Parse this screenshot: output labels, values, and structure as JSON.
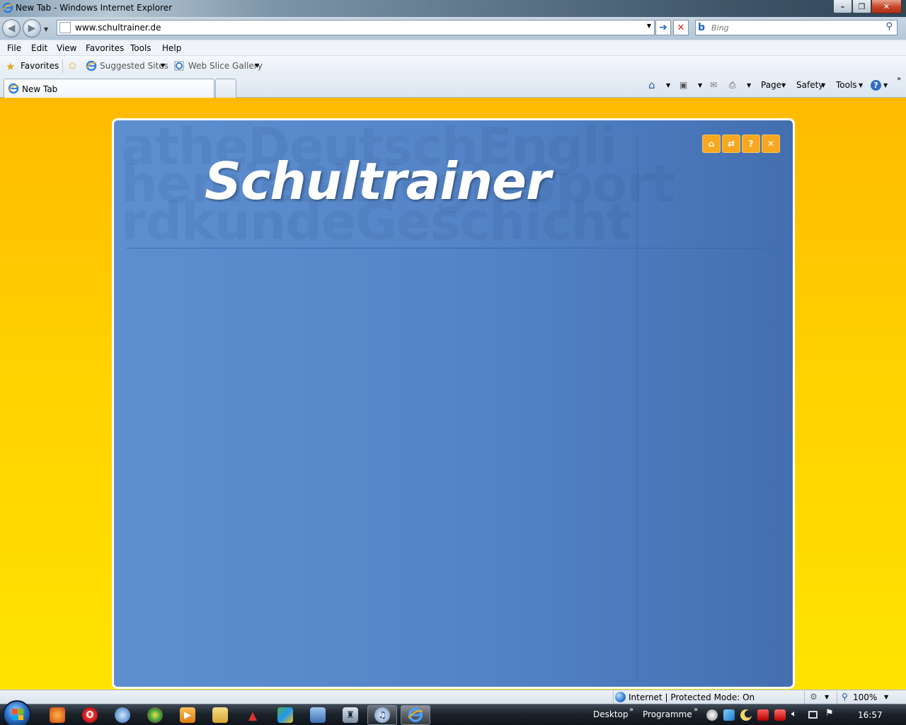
{
  "window": {
    "title": "New Tab - Windows Internet Explorer",
    "controls": {
      "minimize": "–",
      "maximize": "❐",
      "close": "✕"
    }
  },
  "nav": {
    "back_icon": "◀",
    "forward_icon": "▶",
    "url": "www.schultrainer.de",
    "search_placeholder": "Bing"
  },
  "menu": [
    "File",
    "Edit",
    "View",
    "Favorites",
    "Tools",
    "Help"
  ],
  "favorites_bar": {
    "favorites_label": "Favorites",
    "suggested_sites": "Suggested Sites",
    "web_slice_gallery": "Web Slice Gallery"
  },
  "tabs": [
    {
      "label": "New Tab",
      "active": true
    }
  ],
  "command_bar": [
    "Page",
    "Safety",
    "Tools"
  ],
  "page": {
    "background_words": [
      "atheDeutschEngli",
      "hemieBiologieSport",
      "rdkundeGeschicht"
    ],
    "logo_text": "Schultrainer",
    "app_buttons": [
      {
        "icon": "home-icon",
        "glyph": "⌂"
      },
      {
        "icon": "swap-icon",
        "glyph": "⇄"
      },
      {
        "icon": "help-icon",
        "glyph": "?"
      },
      {
        "icon": "close-icon",
        "glyph": "✕"
      }
    ],
    "frame_color": "#5585c8",
    "page_background_color": "#ffd100",
    "button_color": "#f7a820"
  },
  "status": {
    "zone": "Internet | Protected Mode: On",
    "zoom": "100%"
  },
  "taskbar": {
    "desktop_label": "Desktop",
    "programs_label": "Programme",
    "clock": "16:57"
  }
}
